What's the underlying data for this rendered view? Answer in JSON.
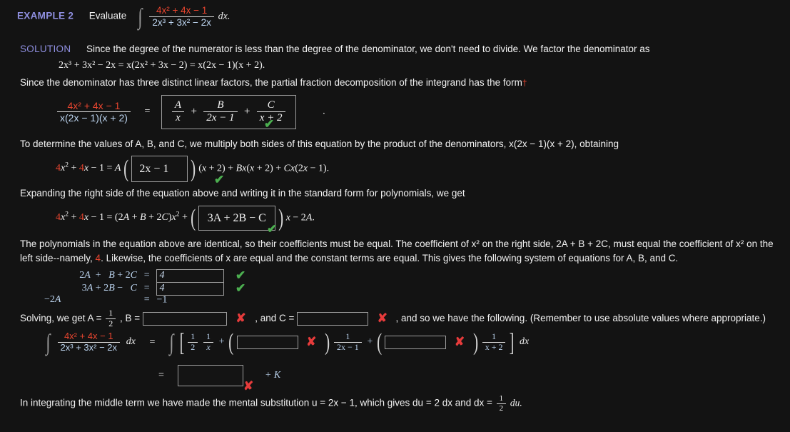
{
  "meta": {
    "background": "#131313",
    "accent_blue": "#8f8fe0",
    "accent_red": "#e8452f",
    "correct_color": "#4caf50",
    "incorrect_color": "#e63b3b"
  },
  "header": {
    "example_label": "EXAMPLE 2",
    "evaluate_label": "Evaluate",
    "integral_numerator": "4x² + 4x − 1",
    "integral_denominator": "2x³ + 3x² − 2x",
    "differential": "dx."
  },
  "solution": {
    "label": "SOLUTION",
    "intro": "Since the degree of the numerator is less than the degree of the denominator, we don't need to divide. We factor the denominator as",
    "factoring_line": "2x³ + 3x² − 2x = x(2x² + 3x − 2) = x(2x − 1)(x + 2).",
    "form_line": "Since the denominator has three distinct linear factors, the partial fraction decomposition of the integrand has the form",
    "form_dagger": "†"
  },
  "decomposition": {
    "lhs_numerator": "4x² + 4x − 1",
    "lhs_denominator": "x(2x − 1)(x + 2)",
    "equals": "=",
    "term1_num": "A",
    "term1_den": "x",
    "plus1": "+",
    "term2_num": "B",
    "term2_den": "2x − 1",
    "plus2": "+",
    "term3_num": "C",
    "term3_den": "x + 2",
    "mark": "✔",
    "mark_state": "correct",
    "trailing_period": "."
  },
  "multiply_step": {
    "text": "To determine the values of A, B, and C, we multiply both sides of this equation by the product of the denominators,  x(2x − 1)(x + 2),  obtaining",
    "lhs": "4x² + 4x − 1 = A",
    "answer_box_value": "2x − 1",
    "rhs": "(x + 2) + Bx(x + 2) + Cx(2x − 1).",
    "mark": "✔",
    "mark_state": "correct"
  },
  "expand_step": {
    "text": "Expanding the right side of the equation above and writing it in the standard form for polynomials, we get",
    "lhs": "4x² + 4x − 1 = (2A + B + 2C)x² + ",
    "answer_box_value": "3A + 2B − C",
    "rhs": "x − 2A.",
    "mark": "✔",
    "mark_state": "correct"
  },
  "coefficients_paragraph": {
    "part1": "The polynomials in the equation above are identical, so their coefficients must be equal. The coefficient of x² on the right side,  2A + B + 2C,  must equal the coefficient of x² on the left side--namely, ",
    "highlight": "4",
    "part2": ". Likewise, the coefficients of x are equal and the constant terms are equal. This gives the following system of equations for A, B, and C."
  },
  "system": {
    "rows": [
      {
        "lhs": "2A +   B + 2C",
        "eq": "=",
        "value": "4",
        "mark": "✔",
        "mark_state": "correct",
        "input": true
      },
      {
        "lhs": "3A + 2B −   C",
        "eq": "=",
        "value": "4",
        "mark": "✔",
        "mark_state": "correct",
        "input": true
      },
      {
        "lhs": "−2A",
        "eq": "=",
        "value": "−1",
        "input": false
      }
    ]
  },
  "solving_line": {
    "prefix": "Solving, we get  A = ",
    "a_value_num": "1",
    "a_value_den": "2",
    "b_label": ",  B =",
    "b_value": "",
    "b_mark": "✘",
    "b_mark_state": "incorrect",
    "c_label": ",  and C =",
    "c_value": "",
    "c_mark": "✘",
    "c_mark_state": "incorrect",
    "suffix": ",  and so we have the following. (Remember to use absolute values where appropriate.)"
  },
  "final_integral": {
    "lhs_numerator": "4x² + 4x − 1",
    "lhs_denominator": "2x³ + 3x² − 2x",
    "lhs_dx": "dx",
    "equals": "=",
    "open_bracket": "[",
    "half_num": "1",
    "half_den": "2",
    "onex_num": "1",
    "onex_den": "x",
    "plus1": "+",
    "box1_value": "",
    "box1_mark": "✘",
    "box1_mark_state": "incorrect",
    "f1_num": "1",
    "f1_den": "2x − 1",
    "plus2": "+",
    "box2_value": "",
    "box2_mark": "✘",
    "box2_mark_state": "incorrect",
    "f2_num": "1",
    "f2_den": "x + 2",
    "close_bracket": "]",
    "rhs_dx": "dx"
  },
  "final_answer": {
    "equals": "=",
    "value": "",
    "plus_k": "+ K",
    "mark": "✘",
    "mark_state": "incorrect"
  },
  "footer": {
    "text_a": "In integrating the middle term we have made the mental substitution  u = 2x − 1,  which gives  du = 2 dx  and  dx = ",
    "half_num": "1",
    "half_den": "2",
    "text_b": " du."
  }
}
